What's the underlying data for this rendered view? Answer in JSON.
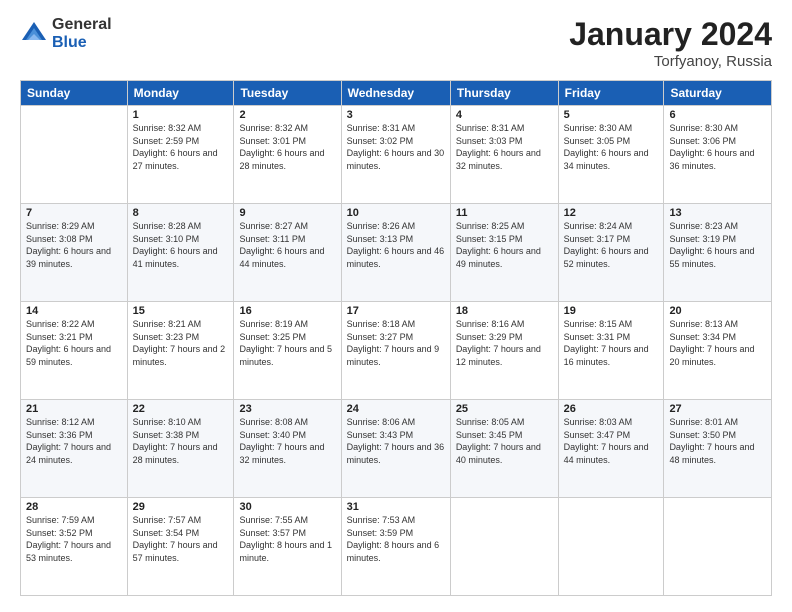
{
  "logo": {
    "general": "General",
    "blue": "Blue"
  },
  "header": {
    "month": "January 2024",
    "location": "Torfyanoy, Russia"
  },
  "weekdays": [
    "Sunday",
    "Monday",
    "Tuesday",
    "Wednesday",
    "Thursday",
    "Friday",
    "Saturday"
  ],
  "rows": [
    [
      {
        "day": "",
        "sunrise": "",
        "sunset": "",
        "daylight": ""
      },
      {
        "day": "1",
        "sunrise": "Sunrise: 8:32 AM",
        "sunset": "Sunset: 2:59 PM",
        "daylight": "Daylight: 6 hours and 27 minutes."
      },
      {
        "day": "2",
        "sunrise": "Sunrise: 8:32 AM",
        "sunset": "Sunset: 3:01 PM",
        "daylight": "Daylight: 6 hours and 28 minutes."
      },
      {
        "day": "3",
        "sunrise": "Sunrise: 8:31 AM",
        "sunset": "Sunset: 3:02 PM",
        "daylight": "Daylight: 6 hours and 30 minutes."
      },
      {
        "day": "4",
        "sunrise": "Sunrise: 8:31 AM",
        "sunset": "Sunset: 3:03 PM",
        "daylight": "Daylight: 6 hours and 32 minutes."
      },
      {
        "day": "5",
        "sunrise": "Sunrise: 8:30 AM",
        "sunset": "Sunset: 3:05 PM",
        "daylight": "Daylight: 6 hours and 34 minutes."
      },
      {
        "day": "6",
        "sunrise": "Sunrise: 8:30 AM",
        "sunset": "Sunset: 3:06 PM",
        "daylight": "Daylight: 6 hours and 36 minutes."
      }
    ],
    [
      {
        "day": "7",
        "sunrise": "Sunrise: 8:29 AM",
        "sunset": "Sunset: 3:08 PM",
        "daylight": "Daylight: 6 hours and 39 minutes."
      },
      {
        "day": "8",
        "sunrise": "Sunrise: 8:28 AM",
        "sunset": "Sunset: 3:10 PM",
        "daylight": "Daylight: 6 hours and 41 minutes."
      },
      {
        "day": "9",
        "sunrise": "Sunrise: 8:27 AM",
        "sunset": "Sunset: 3:11 PM",
        "daylight": "Daylight: 6 hours and 44 minutes."
      },
      {
        "day": "10",
        "sunrise": "Sunrise: 8:26 AM",
        "sunset": "Sunset: 3:13 PM",
        "daylight": "Daylight: 6 hours and 46 minutes."
      },
      {
        "day": "11",
        "sunrise": "Sunrise: 8:25 AM",
        "sunset": "Sunset: 3:15 PM",
        "daylight": "Daylight: 6 hours and 49 minutes."
      },
      {
        "day": "12",
        "sunrise": "Sunrise: 8:24 AM",
        "sunset": "Sunset: 3:17 PM",
        "daylight": "Daylight: 6 hours and 52 minutes."
      },
      {
        "day": "13",
        "sunrise": "Sunrise: 8:23 AM",
        "sunset": "Sunset: 3:19 PM",
        "daylight": "Daylight: 6 hours and 55 minutes."
      }
    ],
    [
      {
        "day": "14",
        "sunrise": "Sunrise: 8:22 AM",
        "sunset": "Sunset: 3:21 PM",
        "daylight": "Daylight: 6 hours and 59 minutes."
      },
      {
        "day": "15",
        "sunrise": "Sunrise: 8:21 AM",
        "sunset": "Sunset: 3:23 PM",
        "daylight": "Daylight: 7 hours and 2 minutes."
      },
      {
        "day": "16",
        "sunrise": "Sunrise: 8:19 AM",
        "sunset": "Sunset: 3:25 PM",
        "daylight": "Daylight: 7 hours and 5 minutes."
      },
      {
        "day": "17",
        "sunrise": "Sunrise: 8:18 AM",
        "sunset": "Sunset: 3:27 PM",
        "daylight": "Daylight: 7 hours and 9 minutes."
      },
      {
        "day": "18",
        "sunrise": "Sunrise: 8:16 AM",
        "sunset": "Sunset: 3:29 PM",
        "daylight": "Daylight: 7 hours and 12 minutes."
      },
      {
        "day": "19",
        "sunrise": "Sunrise: 8:15 AM",
        "sunset": "Sunset: 3:31 PM",
        "daylight": "Daylight: 7 hours and 16 minutes."
      },
      {
        "day": "20",
        "sunrise": "Sunrise: 8:13 AM",
        "sunset": "Sunset: 3:34 PM",
        "daylight": "Daylight: 7 hours and 20 minutes."
      }
    ],
    [
      {
        "day": "21",
        "sunrise": "Sunrise: 8:12 AM",
        "sunset": "Sunset: 3:36 PM",
        "daylight": "Daylight: 7 hours and 24 minutes."
      },
      {
        "day": "22",
        "sunrise": "Sunrise: 8:10 AM",
        "sunset": "Sunset: 3:38 PM",
        "daylight": "Daylight: 7 hours and 28 minutes."
      },
      {
        "day": "23",
        "sunrise": "Sunrise: 8:08 AM",
        "sunset": "Sunset: 3:40 PM",
        "daylight": "Daylight: 7 hours and 32 minutes."
      },
      {
        "day": "24",
        "sunrise": "Sunrise: 8:06 AM",
        "sunset": "Sunset: 3:43 PM",
        "daylight": "Daylight: 7 hours and 36 minutes."
      },
      {
        "day": "25",
        "sunrise": "Sunrise: 8:05 AM",
        "sunset": "Sunset: 3:45 PM",
        "daylight": "Daylight: 7 hours and 40 minutes."
      },
      {
        "day": "26",
        "sunrise": "Sunrise: 8:03 AM",
        "sunset": "Sunset: 3:47 PM",
        "daylight": "Daylight: 7 hours and 44 minutes."
      },
      {
        "day": "27",
        "sunrise": "Sunrise: 8:01 AM",
        "sunset": "Sunset: 3:50 PM",
        "daylight": "Daylight: 7 hours and 48 minutes."
      }
    ],
    [
      {
        "day": "28",
        "sunrise": "Sunrise: 7:59 AM",
        "sunset": "Sunset: 3:52 PM",
        "daylight": "Daylight: 7 hours and 53 minutes."
      },
      {
        "day": "29",
        "sunrise": "Sunrise: 7:57 AM",
        "sunset": "Sunset: 3:54 PM",
        "daylight": "Daylight: 7 hours and 57 minutes."
      },
      {
        "day": "30",
        "sunrise": "Sunrise: 7:55 AM",
        "sunset": "Sunset: 3:57 PM",
        "daylight": "Daylight: 8 hours and 1 minute."
      },
      {
        "day": "31",
        "sunrise": "Sunrise: 7:53 AM",
        "sunset": "Sunset: 3:59 PM",
        "daylight": "Daylight: 8 hours and 6 minutes."
      },
      {
        "day": "",
        "sunrise": "",
        "sunset": "",
        "daylight": ""
      },
      {
        "day": "",
        "sunrise": "",
        "sunset": "",
        "daylight": ""
      },
      {
        "day": "",
        "sunrise": "",
        "sunset": "",
        "daylight": ""
      }
    ]
  ]
}
